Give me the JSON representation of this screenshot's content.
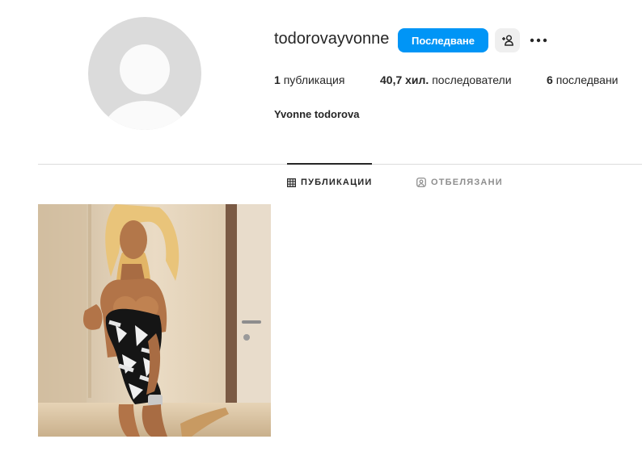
{
  "profile": {
    "username": "todorovayvonne",
    "full_name": "Yvonne todorova",
    "follow_label": "Последване",
    "suggest_icon": "person-plus-icon",
    "more_icon": "more-horizontal-icon",
    "avatar_icon": "default-avatar-icon"
  },
  "stats": {
    "posts_value": "1",
    "posts_label": "публикация",
    "followers_value": "40,7 хил.",
    "followers_label": "последователи",
    "following_value": "6",
    "following_label": "последвани"
  },
  "tabs": [
    {
      "label": "ПУБЛИКАЦИИ",
      "icon": "grid-icon",
      "active": true
    },
    {
      "label": "ОТБЕЛЯЗАНИ",
      "icon": "tagged-icon",
      "active": false
    }
  ],
  "posts": [
    {
      "type": "photo"
    }
  ],
  "colors": {
    "primary_button": "#0095f6",
    "secondary_button": "#efefef",
    "divider": "#dbdbdb",
    "muted_text": "#8e8e8e"
  }
}
